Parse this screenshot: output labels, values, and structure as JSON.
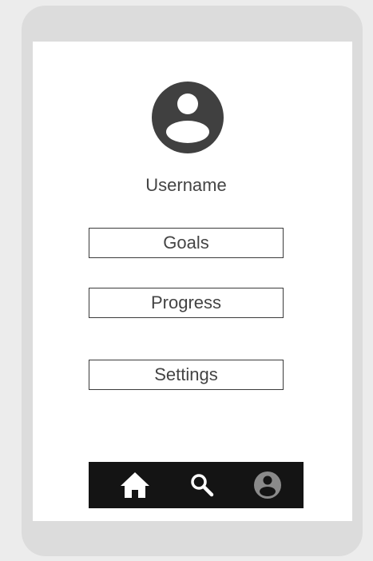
{
  "profile": {
    "username": "Username",
    "avatar_icon": "account-circle-icon"
  },
  "menu": {
    "goals_label": "Goals",
    "progress_label": "Progress",
    "settings_label": "Settings"
  },
  "bottom_nav": {
    "items": [
      {
        "icon": "home-icon",
        "color": "#ffffff"
      },
      {
        "icon": "search-icon",
        "color": "#ffffff"
      },
      {
        "icon": "account-circle-icon",
        "color": "#8a8a8a"
      }
    ],
    "background": "#141414"
  },
  "colors": {
    "avatar": "#404040",
    "text": "#444444",
    "frame": "#dcdcdc"
  }
}
